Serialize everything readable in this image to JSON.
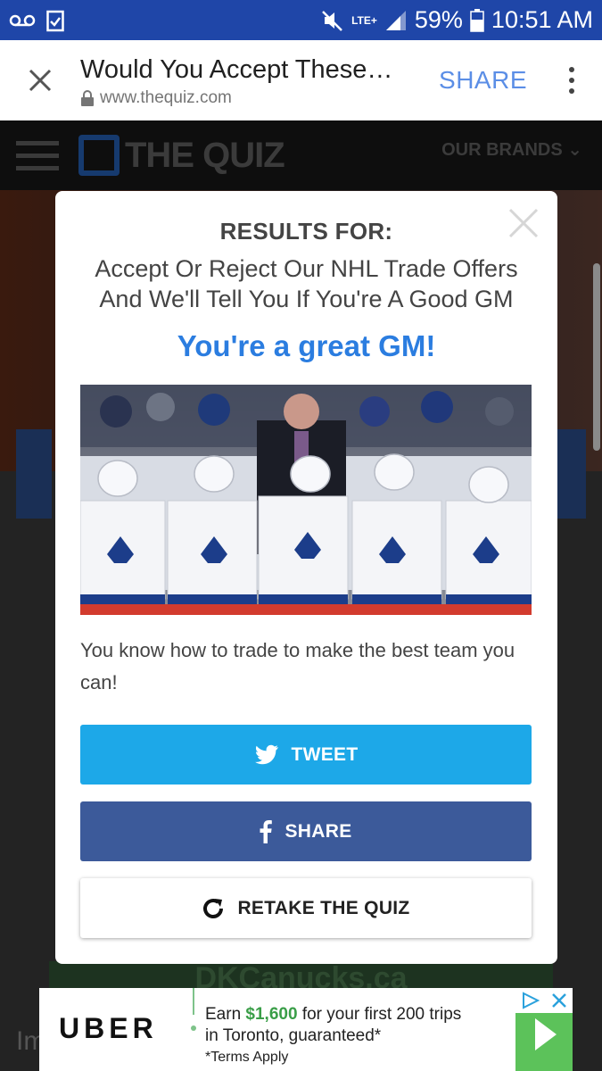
{
  "status_bar": {
    "signal_label": "LTE+",
    "battery": "59%",
    "time": "10:51 AM",
    "icons": [
      "voicemail-icon",
      "clipboard-check-icon",
      "mute-icon",
      "signal-icon",
      "battery-icon"
    ]
  },
  "toolbar": {
    "title": "Would You Accept These…",
    "url": "www.thequiz.com",
    "share_label": "SHARE"
  },
  "site": {
    "logo_text": "THE QUIZ",
    "brands_label": "OUR BRANDS",
    "footer_text": "DKCanucks.ca",
    "im_text": "Im"
  },
  "modal": {
    "results_for": "RESULTS FOR:",
    "quiz_title": "Accept Or Reject Our NHL Trade Offers And We'll Tell You If You're A Good GM",
    "result_head": "You're a great GM!",
    "result_desc": "You know how to trade to make the best team you can!",
    "tweet_label": "TWEET",
    "share_label": "SHARE",
    "retake_label": "RETAKE THE QUIZ"
  },
  "ad": {
    "brand": "UBER",
    "line1_pre": "Earn ",
    "amount": "$1,600",
    "line1_post": " for your first 200 trips",
    "line2": "in Toronto, guaranteed*",
    "terms": "*Terms Apply"
  },
  "colors": {
    "status_bar": "#1f46a8",
    "accent_blue": "#2b7de0",
    "tweet": "#1da8e8",
    "facebook": "#3c5a9a",
    "uber_green": "#5cc25a"
  }
}
